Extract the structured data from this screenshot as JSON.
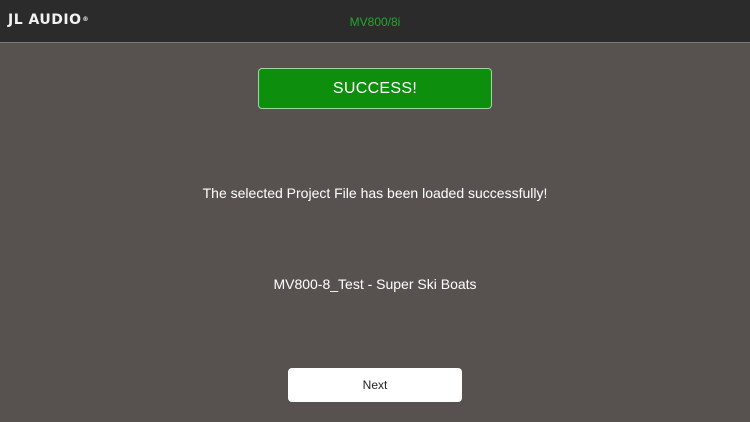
{
  "header": {
    "logo_text": "JL AUDIO",
    "logo_mark": "®",
    "device_name": "MV800/8i"
  },
  "status": {
    "banner_label": "SUCCESS!",
    "message": "The selected Project File has been loaded successfully!",
    "project_name": "MV800-8_Test - Super Ski Boats"
  },
  "actions": {
    "next_label": "Next"
  },
  "colors": {
    "background": "#57524f",
    "topbar": "#2b2b2b",
    "device_text": "#1faa2a",
    "success": "#0d8f0d"
  }
}
